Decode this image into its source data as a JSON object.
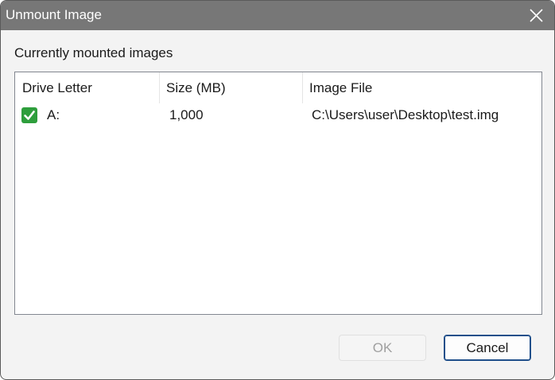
{
  "window": {
    "title": "Unmount Image"
  },
  "main": {
    "section_label": "Currently mounted images",
    "columns": [
      "Drive Letter",
      "Size (MB)",
      "Image File"
    ],
    "rows": [
      {
        "status_icon": "green-check-icon",
        "drive_letter": "A:",
        "size_mb": "1,000",
        "image_file": "C:\\Users\\user\\Desktop\\test.img"
      }
    ]
  },
  "buttons": {
    "ok_label": "OK",
    "ok_enabled": false,
    "cancel_label": "Cancel"
  },
  "colors": {
    "titlebar": "#777777",
    "check_green": "#2e9e3c",
    "focus_border": "#1f4f8a"
  }
}
